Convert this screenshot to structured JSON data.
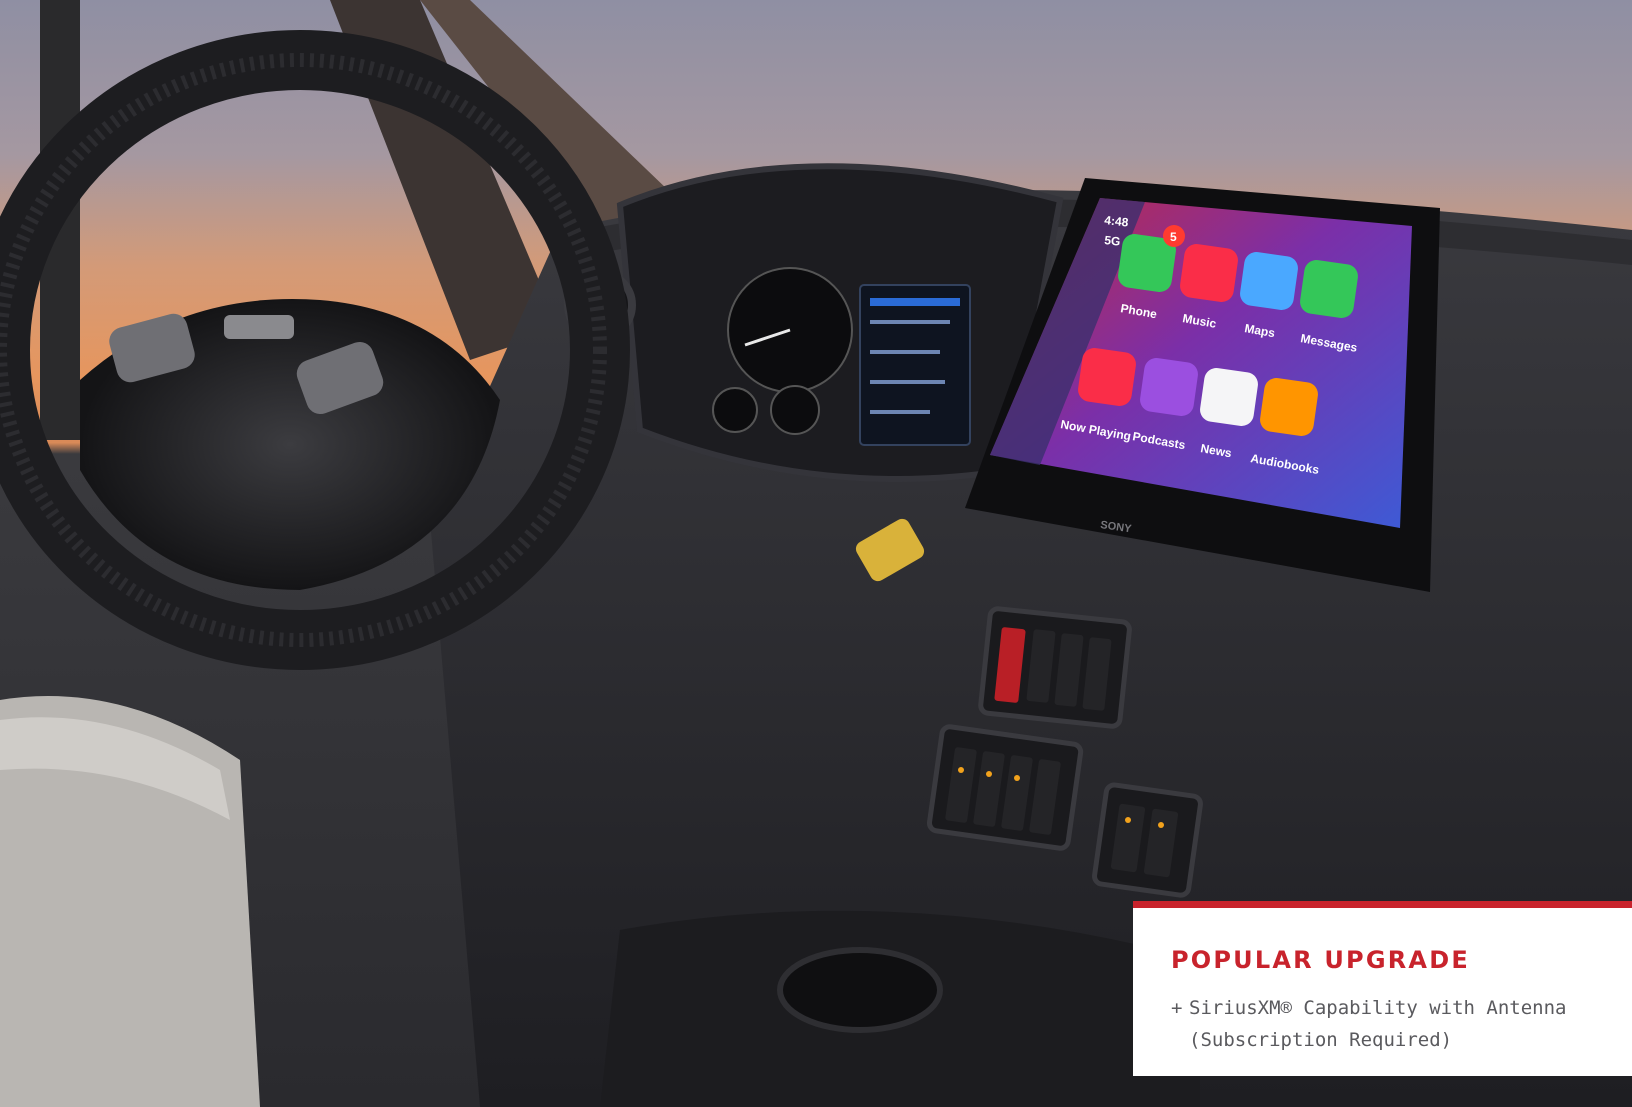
{
  "photo": {
    "subject": "truck-cab-interior",
    "colors": {
      "sky_top": "#8f8fa3",
      "sky_sunset": "#e6965e",
      "dash": "#2b2b2f",
      "accent_red": "#c8232c",
      "switch_amber": "#f2a21c"
    },
    "screen": {
      "brand": "SONY",
      "status": {
        "time": "4:48",
        "signal": "5G"
      },
      "badge_count": "5",
      "apps": [
        {
          "label": "Phone",
          "icon": "phone-app-icon"
        },
        {
          "label": "Music",
          "icon": "music-app-icon"
        },
        {
          "label": "Maps",
          "icon": "maps-app-icon"
        },
        {
          "label": "Messages",
          "icon": "messages-app-icon"
        },
        {
          "label": "Now Playing",
          "icon": "now-playing-app-icon"
        },
        {
          "label": "Podcasts",
          "icon": "podcasts-app-icon"
        },
        {
          "label": "News",
          "icon": "news-app-icon"
        },
        {
          "label": "Audiobooks",
          "icon": "audiobooks-app-icon"
        }
      ]
    }
  },
  "callout": {
    "title": "POPULAR UPGRADE",
    "items": [
      {
        "bullet": "+",
        "line1": "SiriusXM® Capability with Antenna",
        "line2": "(Subscription Required)"
      }
    ]
  }
}
